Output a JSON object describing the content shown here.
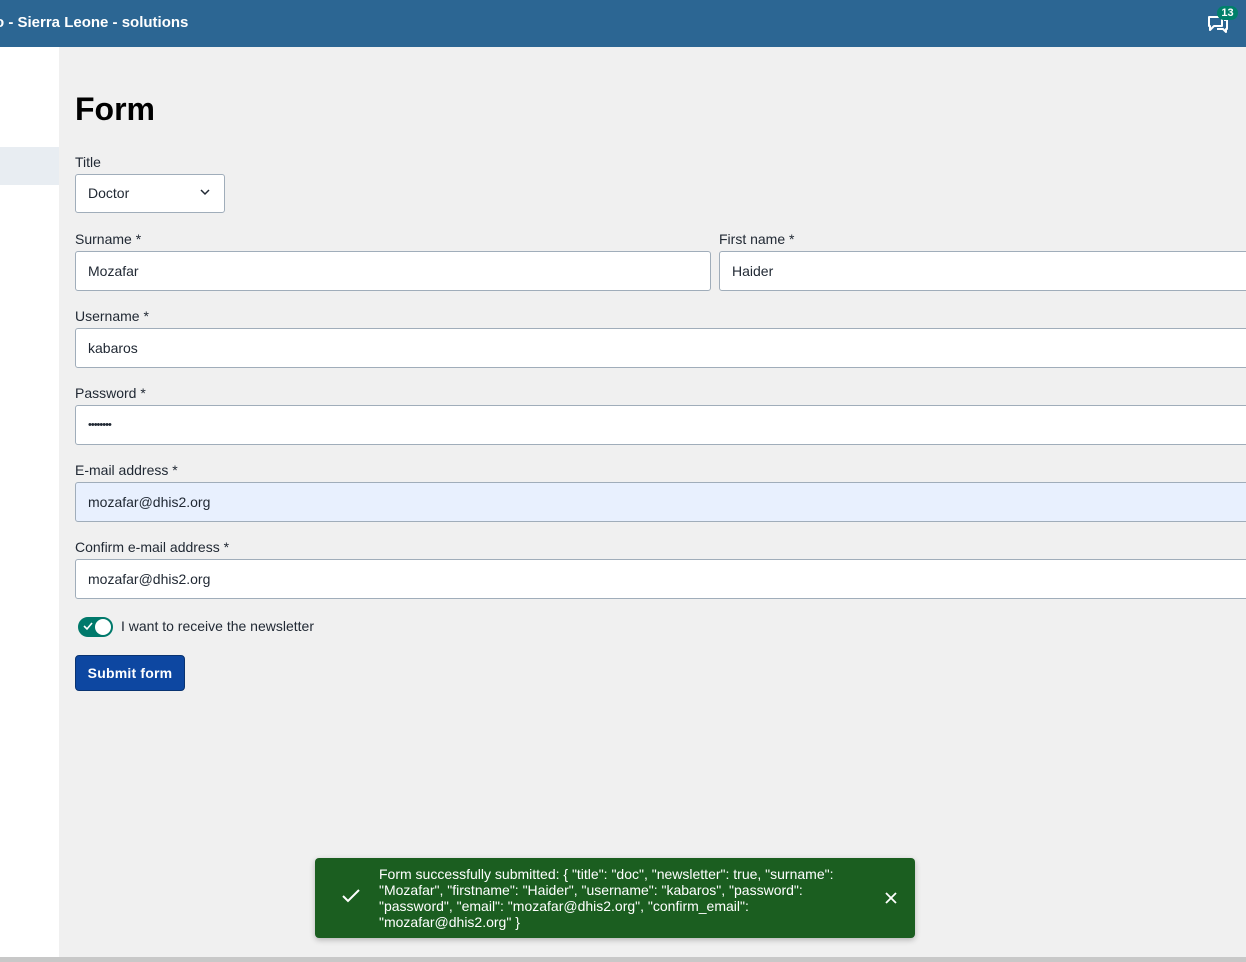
{
  "header": {
    "title": "o - Sierra Leone - solutions",
    "message_count": "13"
  },
  "form": {
    "heading": "Form",
    "title_label": "Title",
    "title_value": "Doctor",
    "surname_label": "Surname *",
    "surname_value": "Mozafar",
    "firstname_label": "First name *",
    "firstname_value": "Haider",
    "username_label": "Username *",
    "username_value": "kabaros",
    "password_label": "Password *",
    "password_value": "••••••••",
    "email_label": "E-mail address *",
    "email_value": "mozafar@dhis2.org",
    "confirm_email_label": "Confirm e-mail address *",
    "confirm_email_value": "mozafar@dhis2.org",
    "newsletter_label": "I want to receive the newsletter",
    "newsletter_checked": true,
    "submit_label": "Submit form"
  },
  "alert": {
    "message": "Form successfully submitted: { \"title\": \"doc\", \"newsletter\": true, \"surname\": \"Mozafar\", \"firstname\": \"Haider\", \"username\": \"kabaros\", \"password\": \"password\", \"email\": \"mozafar@dhis2.org\", \"confirm_email\": \"mozafar@dhis2.org\" }"
  },
  "colors": {
    "header_bg": "#2c6693",
    "submit_bg": "#0d47a1",
    "switch_bg": "#00796b",
    "alert_bg": "#1b5e20",
    "badge_bg": "#00806a"
  }
}
